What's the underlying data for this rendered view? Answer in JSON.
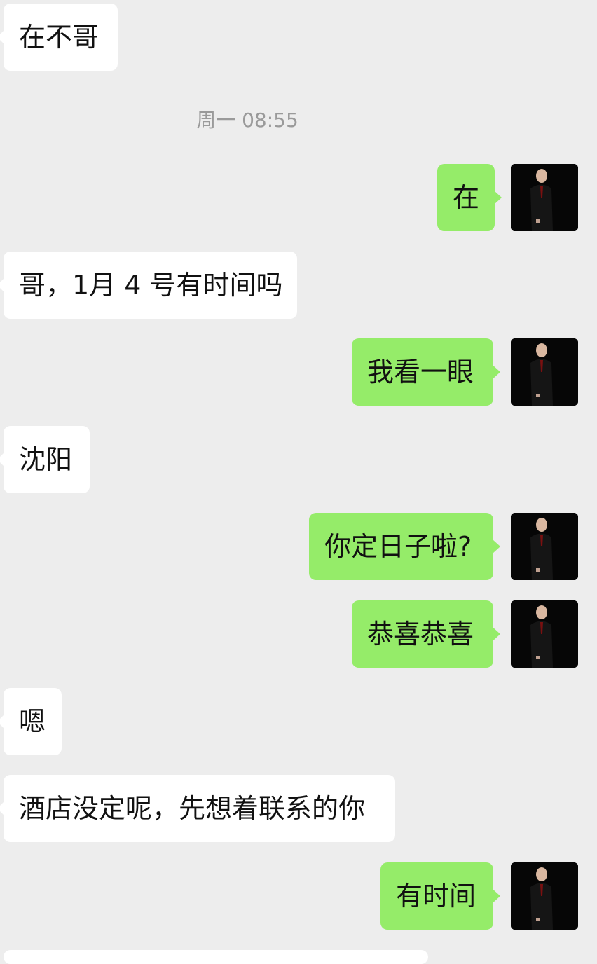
{
  "messages": [
    {
      "side": "in",
      "text": "在不哥"
    },
    {
      "side": "out",
      "text": "在"
    },
    {
      "side": "in",
      "text": "哥，1月 4 号有时间吗"
    },
    {
      "side": "out",
      "text": "我看一眼"
    },
    {
      "side": "in",
      "text": "沈阳"
    },
    {
      "side": "out",
      "text": "你定日子啦?"
    },
    {
      "side": "out",
      "text": "恭喜恭喜"
    },
    {
      "side": "in",
      "text": "嗯"
    },
    {
      "side": "in",
      "text": "酒店没定呢，先想着联系的你"
    },
    {
      "side": "out",
      "text": "有时间"
    }
  ],
  "timestamp": "周一 08:55",
  "colors": {
    "background": "#ededed",
    "incoming_bubble": "#ffffff",
    "outgoing_bubble": "#95ec69",
    "timestamp_text": "#9a9a9a"
  },
  "icons": {
    "avatar": "user-avatar-photo"
  }
}
